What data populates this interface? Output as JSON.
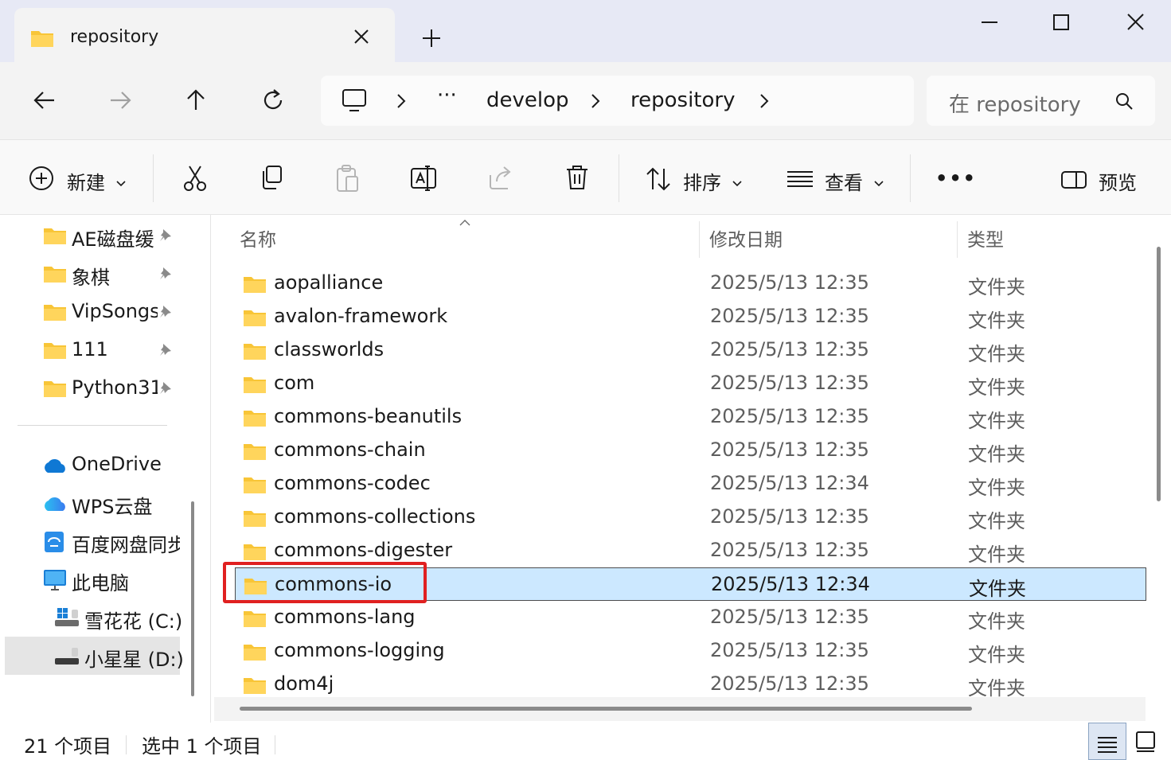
{
  "tab": {
    "title": "repository"
  },
  "address": {
    "ellipsis": "···",
    "crumbs": [
      "develop",
      "repository"
    ]
  },
  "search": {
    "placeholder": "在 repository"
  },
  "commands": {
    "new": "新建",
    "sort": "排序",
    "view": "查看",
    "more": "•••",
    "preview": "预览"
  },
  "sidebar": {
    "pinned": [
      {
        "label": "AE磁盘缓"
      },
      {
        "label": "象棋"
      },
      {
        "label": "VipSongs"
      },
      {
        "label": "111"
      },
      {
        "label": "Python31"
      }
    ],
    "locations": [
      {
        "label": "OneDrive",
        "icon": "onedrive-icon"
      },
      {
        "label": "WPS云盘",
        "icon": "wps-cloud-icon"
      },
      {
        "label": "百度网盘同步",
        "icon": "baidu-netdisk-icon"
      },
      {
        "label": "此电脑",
        "icon": "this-pc-icon"
      },
      {
        "label": "雪花花 (C:)",
        "icon": "windows-drive-icon"
      },
      {
        "label": "小星星 (D:)",
        "icon": "drive-icon"
      }
    ]
  },
  "columns": {
    "name": "名称",
    "date": "修改日期",
    "type": "类型"
  },
  "files": [
    {
      "name": "aopalliance",
      "date": "2025/5/13 12:35",
      "type": "文件夹"
    },
    {
      "name": "avalon-framework",
      "date": "2025/5/13 12:35",
      "type": "文件夹"
    },
    {
      "name": "classworlds",
      "date": "2025/5/13 12:35",
      "type": "文件夹"
    },
    {
      "name": "com",
      "date": "2025/5/13 12:35",
      "type": "文件夹"
    },
    {
      "name": "commons-beanutils",
      "date": "2025/5/13 12:35",
      "type": "文件夹"
    },
    {
      "name": "commons-chain",
      "date": "2025/5/13 12:35",
      "type": "文件夹"
    },
    {
      "name": "commons-codec",
      "date": "2025/5/13 12:34",
      "type": "文件夹"
    },
    {
      "name": "commons-collections",
      "date": "2025/5/13 12:35",
      "type": "文件夹"
    },
    {
      "name": "commons-digester",
      "date": "2025/5/13 12:35",
      "type": "文件夹"
    },
    {
      "name": "commons-io",
      "date": "2025/5/13 12:34",
      "type": "文件夹"
    },
    {
      "name": "commons-lang",
      "date": "2025/5/13 12:35",
      "type": "文件夹"
    },
    {
      "name": "commons-logging",
      "date": "2025/5/13 12:35",
      "type": "文件夹"
    },
    {
      "name": "dom4j",
      "date": "2025/5/13 12:35",
      "type": "文件夹"
    }
  ],
  "status": {
    "count": "21 个项目",
    "selected": "选中 1 个项目"
  },
  "colors": {
    "accent": "#0067c0",
    "selection": "#cce8ff",
    "highlight": "#e02020",
    "folder": "#f8c537"
  }
}
